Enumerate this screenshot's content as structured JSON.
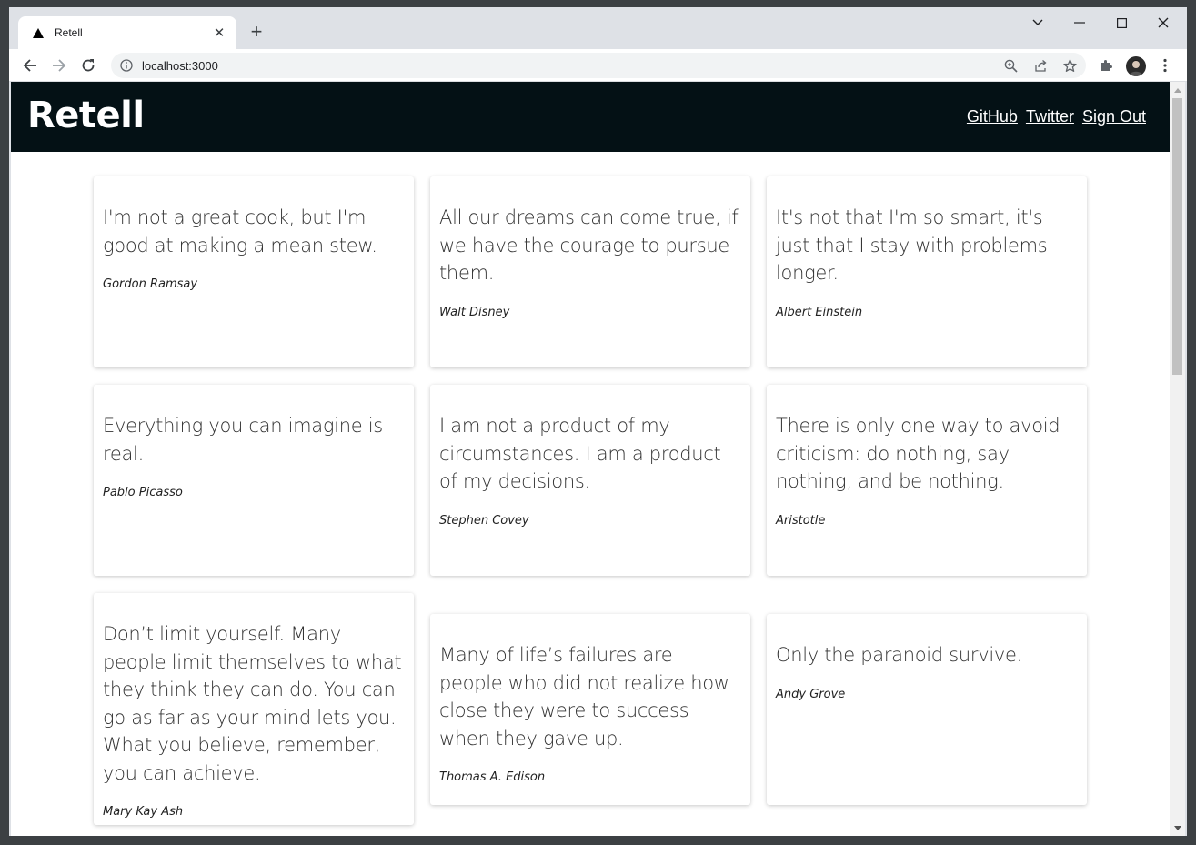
{
  "browser": {
    "tab_title": "Retell",
    "url": "localhost:3000"
  },
  "site": {
    "brand": "Retell",
    "nav": [
      "GitHub",
      "Twitter",
      "Sign Out"
    ]
  },
  "quotes": [
    {
      "text": "I'm not a great cook, but I'm good at making a mean stew.",
      "author": "Gordon Ramsay"
    },
    {
      "text": "All our dreams can come true, if we have the courage to pursue them.",
      "author": "Walt Disney"
    },
    {
      "text": "It's not that I'm so smart, it's just that I stay with problems longer.",
      "author": "Albert Einstein"
    },
    {
      "text": "Everything you can imagine is real.",
      "author": "Pablo Picasso"
    },
    {
      "text": "I am not a product of my circumstances. I am a product of my decisions.",
      "author": "Stephen Covey"
    },
    {
      "text": "There is only one way to avoid criticism: do nothing, say nothing, and be nothing.",
      "author": "Aristotle"
    },
    {
      "text": "Don’t limit yourself. Many people limit themselves to what they think they can do. You can go as far as your mind lets you. What you believe, remember, you can achieve.",
      "author": "Mary Kay Ash"
    },
    {
      "text": "Many of life’s failures are people who did not realize how close they were to success when they gave up.",
      "author": "Thomas A. Edison"
    },
    {
      "text": "Only the paranoid survive.",
      "author": "Andy Grove"
    }
  ],
  "icons": {
    "favicon": "triangle-icon",
    "back": "arrow-left-icon",
    "forward": "arrow-right-icon",
    "reload": "reload-icon",
    "info": "info-icon",
    "zoom": "zoom-icon",
    "share": "share-icon",
    "bookmark": "star-icon",
    "extensions": "puzzle-icon"
  },
  "colors": {
    "header_bg": "#041115",
    "page_bg": "#ffffff",
    "chrome_bg": "#dee1e6"
  }
}
